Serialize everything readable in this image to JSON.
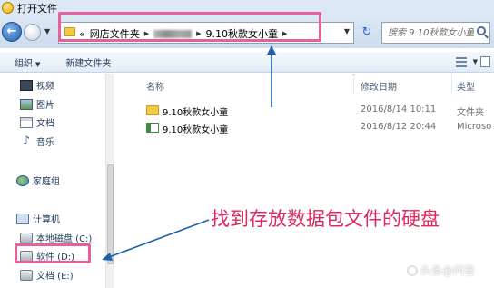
{
  "window": {
    "title": "打开文件"
  },
  "nav": {
    "back_label": "←",
    "refresh_label": "↻",
    "breadcrumbs": [
      "«",
      "网店文件夹",
      "9.10秋款女小童"
    ],
    "search_placeholder": "搜索 9.10秋款女小童"
  },
  "toolbar": {
    "organize_label": "组织",
    "new_folder_label": "新建文件夹"
  },
  "sidebar": {
    "libraries": [
      {
        "label": "视频",
        "icon": "video-icon"
      },
      {
        "label": "图片",
        "icon": "picture-icon"
      },
      {
        "label": "文档",
        "icon": "document-icon"
      },
      {
        "label": "音乐",
        "icon": "music-icon"
      }
    ],
    "homegroup": {
      "label": "家庭组",
      "icon": "homegroup-icon"
    },
    "computer": {
      "label": "计算机",
      "icon": "computer-icon"
    },
    "drives": [
      {
        "label": "本地磁盘 (C:)",
        "icon": "drive-icon"
      },
      {
        "label": "软件 (D:)",
        "icon": "drive-icon"
      },
      {
        "label": "文档 (E:)",
        "icon": "drive-icon"
      }
    ]
  },
  "columns": {
    "name": "名称",
    "date": "修改日期",
    "type": "类型"
  },
  "files": [
    {
      "name": "9.10秋款女小童",
      "date": "2016/8/14 10:11",
      "type": "文件夹",
      "icon": "folder-icon"
    },
    {
      "name": "9.10秋款女小童",
      "date": "2016/8/12 20:44",
      "type": "Microso",
      "icon": "spreadsheet-icon"
    }
  ],
  "annotation": {
    "text": "找到存放数据包文件的硬盘",
    "color": "#e0285e"
  },
  "highlight_color": "#e8609a",
  "watermark": {
    "text": "头条@问答"
  }
}
